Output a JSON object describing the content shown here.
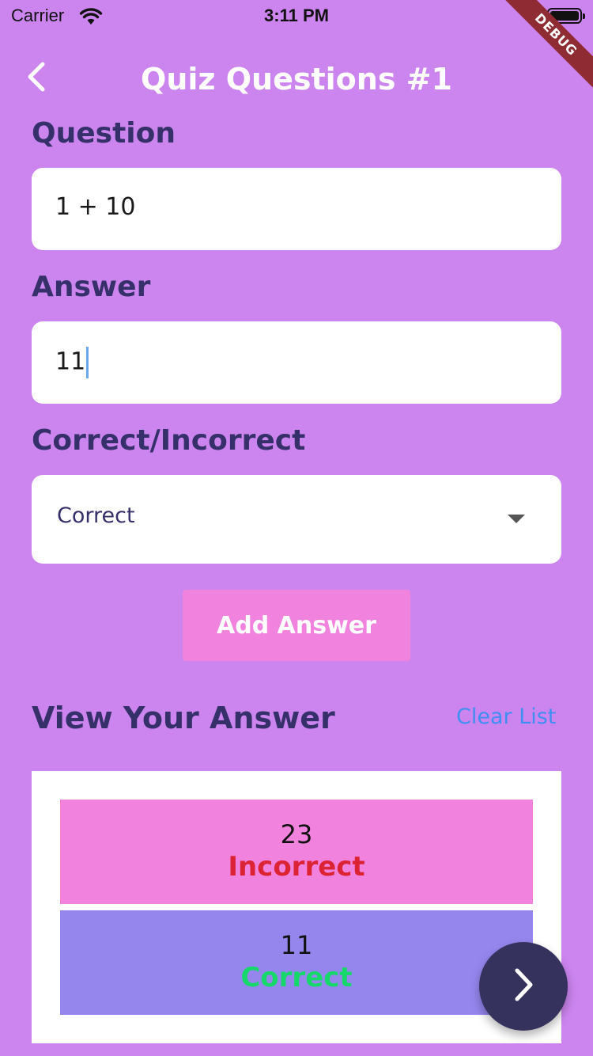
{
  "status_bar": {
    "carrier": "Carrier",
    "time": "3:11 PM",
    "debug_label": "DEBUG"
  },
  "app_bar": {
    "title": "Quiz Questions #1",
    "back_icon": "chevron-left-icon"
  },
  "form": {
    "question_label": "Question",
    "question_value": "1 + 10",
    "answer_label": "Answer",
    "answer_value": "11",
    "correctness_label": "Correct/Incorrect",
    "correctness_selected": "Correct",
    "add_button_label": "Add Answer"
  },
  "answers_section": {
    "title": "View Your Answer",
    "clear_label": "Clear List",
    "items": [
      {
        "value": "23",
        "status": "Incorrect"
      },
      {
        "value": "11",
        "status": "Correct"
      }
    ]
  },
  "fab": {
    "icon": "chevron-right-icon"
  },
  "colors": {
    "background": "#cc85ef",
    "heading": "#36306a",
    "accent_pink": "#f183de",
    "accent_purple": "#9586ee",
    "incorrect": "#dc2334",
    "correct": "#16d86a",
    "link": "#3f8ef2",
    "fab": "#36325e"
  }
}
